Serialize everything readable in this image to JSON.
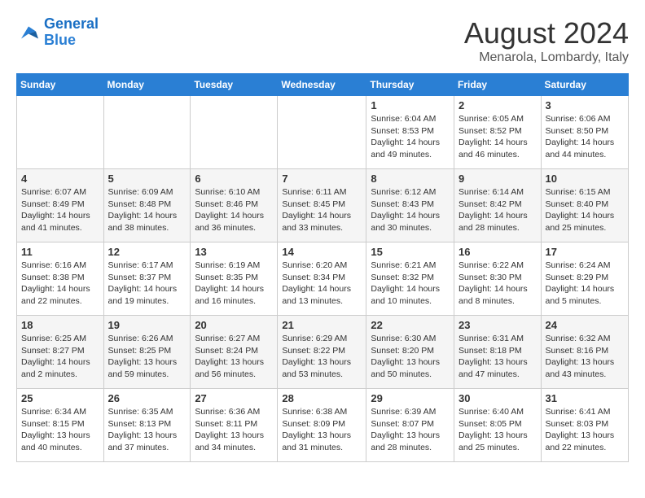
{
  "header": {
    "logo_line1": "General",
    "logo_line2": "Blue",
    "month_year": "August 2024",
    "location": "Menarola, Lombardy, Italy"
  },
  "weekdays": [
    "Sunday",
    "Monday",
    "Tuesday",
    "Wednesday",
    "Thursday",
    "Friday",
    "Saturday"
  ],
  "weeks": [
    [
      {
        "day": "",
        "info": ""
      },
      {
        "day": "",
        "info": ""
      },
      {
        "day": "",
        "info": ""
      },
      {
        "day": "",
        "info": ""
      },
      {
        "day": "1",
        "info": "Sunrise: 6:04 AM\nSunset: 8:53 PM\nDaylight: 14 hours\nand 49 minutes."
      },
      {
        "day": "2",
        "info": "Sunrise: 6:05 AM\nSunset: 8:52 PM\nDaylight: 14 hours\nand 46 minutes."
      },
      {
        "day": "3",
        "info": "Sunrise: 6:06 AM\nSunset: 8:50 PM\nDaylight: 14 hours\nand 44 minutes."
      }
    ],
    [
      {
        "day": "4",
        "info": "Sunrise: 6:07 AM\nSunset: 8:49 PM\nDaylight: 14 hours\nand 41 minutes."
      },
      {
        "day": "5",
        "info": "Sunrise: 6:09 AM\nSunset: 8:48 PM\nDaylight: 14 hours\nand 38 minutes."
      },
      {
        "day": "6",
        "info": "Sunrise: 6:10 AM\nSunset: 8:46 PM\nDaylight: 14 hours\nand 36 minutes."
      },
      {
        "day": "7",
        "info": "Sunrise: 6:11 AM\nSunset: 8:45 PM\nDaylight: 14 hours\nand 33 minutes."
      },
      {
        "day": "8",
        "info": "Sunrise: 6:12 AM\nSunset: 8:43 PM\nDaylight: 14 hours\nand 30 minutes."
      },
      {
        "day": "9",
        "info": "Sunrise: 6:14 AM\nSunset: 8:42 PM\nDaylight: 14 hours\nand 28 minutes."
      },
      {
        "day": "10",
        "info": "Sunrise: 6:15 AM\nSunset: 8:40 PM\nDaylight: 14 hours\nand 25 minutes."
      }
    ],
    [
      {
        "day": "11",
        "info": "Sunrise: 6:16 AM\nSunset: 8:38 PM\nDaylight: 14 hours\nand 22 minutes."
      },
      {
        "day": "12",
        "info": "Sunrise: 6:17 AM\nSunset: 8:37 PM\nDaylight: 14 hours\nand 19 minutes."
      },
      {
        "day": "13",
        "info": "Sunrise: 6:19 AM\nSunset: 8:35 PM\nDaylight: 14 hours\nand 16 minutes."
      },
      {
        "day": "14",
        "info": "Sunrise: 6:20 AM\nSunset: 8:34 PM\nDaylight: 14 hours\nand 13 minutes."
      },
      {
        "day": "15",
        "info": "Sunrise: 6:21 AM\nSunset: 8:32 PM\nDaylight: 14 hours\nand 10 minutes."
      },
      {
        "day": "16",
        "info": "Sunrise: 6:22 AM\nSunset: 8:30 PM\nDaylight: 14 hours\nand 8 minutes."
      },
      {
        "day": "17",
        "info": "Sunrise: 6:24 AM\nSunset: 8:29 PM\nDaylight: 14 hours\nand 5 minutes."
      }
    ],
    [
      {
        "day": "18",
        "info": "Sunrise: 6:25 AM\nSunset: 8:27 PM\nDaylight: 14 hours\nand 2 minutes."
      },
      {
        "day": "19",
        "info": "Sunrise: 6:26 AM\nSunset: 8:25 PM\nDaylight: 13 hours\nand 59 minutes."
      },
      {
        "day": "20",
        "info": "Sunrise: 6:27 AM\nSunset: 8:24 PM\nDaylight: 13 hours\nand 56 minutes."
      },
      {
        "day": "21",
        "info": "Sunrise: 6:29 AM\nSunset: 8:22 PM\nDaylight: 13 hours\nand 53 minutes."
      },
      {
        "day": "22",
        "info": "Sunrise: 6:30 AM\nSunset: 8:20 PM\nDaylight: 13 hours\nand 50 minutes."
      },
      {
        "day": "23",
        "info": "Sunrise: 6:31 AM\nSunset: 8:18 PM\nDaylight: 13 hours\nand 47 minutes."
      },
      {
        "day": "24",
        "info": "Sunrise: 6:32 AM\nSunset: 8:16 PM\nDaylight: 13 hours\nand 43 minutes."
      }
    ],
    [
      {
        "day": "25",
        "info": "Sunrise: 6:34 AM\nSunset: 8:15 PM\nDaylight: 13 hours\nand 40 minutes."
      },
      {
        "day": "26",
        "info": "Sunrise: 6:35 AM\nSunset: 8:13 PM\nDaylight: 13 hours\nand 37 minutes."
      },
      {
        "day": "27",
        "info": "Sunrise: 6:36 AM\nSunset: 8:11 PM\nDaylight: 13 hours\nand 34 minutes."
      },
      {
        "day": "28",
        "info": "Sunrise: 6:38 AM\nSunset: 8:09 PM\nDaylight: 13 hours\nand 31 minutes."
      },
      {
        "day": "29",
        "info": "Sunrise: 6:39 AM\nSunset: 8:07 PM\nDaylight: 13 hours\nand 28 minutes."
      },
      {
        "day": "30",
        "info": "Sunrise: 6:40 AM\nSunset: 8:05 PM\nDaylight: 13 hours\nand 25 minutes."
      },
      {
        "day": "31",
        "info": "Sunrise: 6:41 AM\nSunset: 8:03 PM\nDaylight: 13 hours\nand 22 minutes."
      }
    ]
  ]
}
